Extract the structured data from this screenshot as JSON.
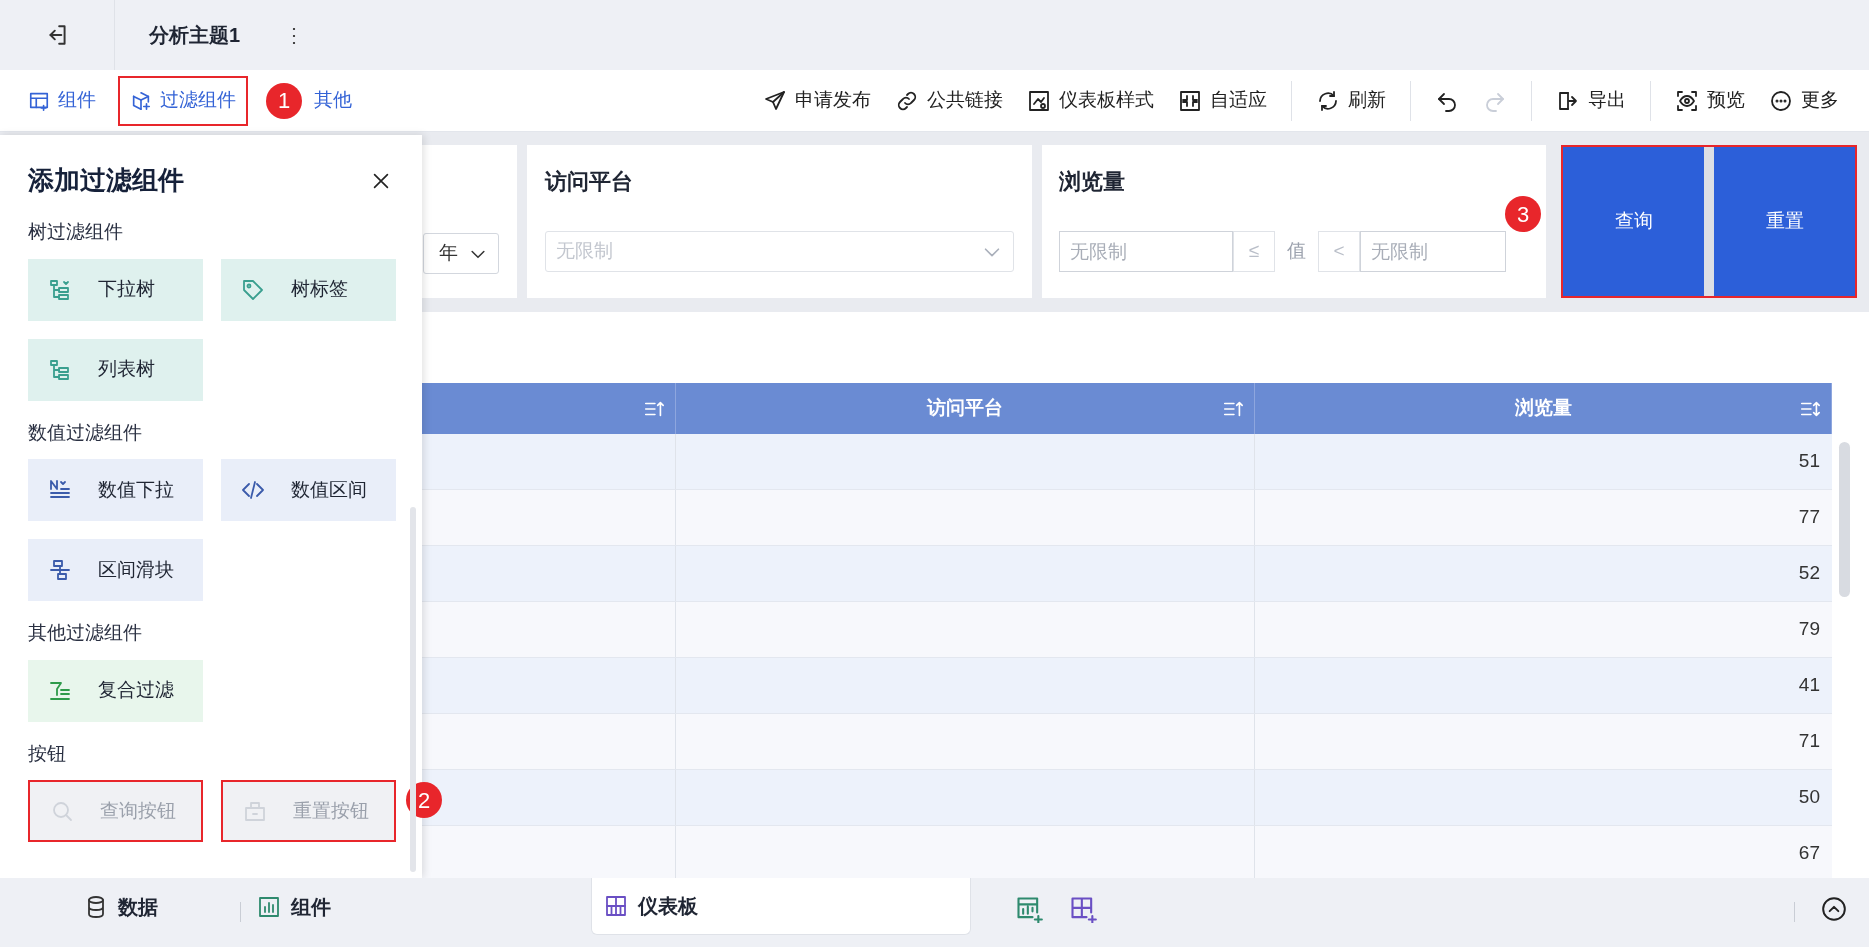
{
  "header": {
    "title": "分析主题1",
    "more": "⋮"
  },
  "toolbar": {
    "tabs": [
      {
        "label": "组件"
      },
      {
        "label": "过滤组件",
        "callout": "1"
      },
      {
        "label": "其他"
      }
    ],
    "groups": [
      [
        {
          "label": "申请发布"
        },
        {
          "label": "公共链接"
        },
        {
          "label": "仪表板样式"
        },
        {
          "label": "自适应"
        }
      ],
      [
        {
          "label": "刷新"
        }
      ],
      [
        {
          "disabled": false
        },
        {
          "disabled": true
        }
      ],
      [
        {
          "label": "导出"
        }
      ],
      [
        {
          "label": "预览"
        },
        {
          "label": "更多"
        }
      ]
    ]
  },
  "panel": {
    "title": "添加过滤组件",
    "callout": "2",
    "sections": [
      {
        "title": "树过滤组件",
        "kind": "tree",
        "items": [
          {
            "label": "下拉树",
            "disabled": false
          },
          {
            "label": "树标签",
            "disabled": false
          },
          {
            "label": "列表树",
            "disabled": false
          }
        ]
      },
      {
        "title": "数值过滤组件",
        "kind": "numeric",
        "items": [
          {
            "label": "数值下拉",
            "disabled": false
          },
          {
            "label": "数值区间",
            "disabled": false
          },
          {
            "label": "区间滑块",
            "disabled": false
          }
        ]
      },
      {
        "title": "其他过滤组件",
        "kind": "other",
        "items": [
          {
            "label": "复合过滤",
            "disabled": false
          }
        ]
      },
      {
        "title": "按钮",
        "kind": "button",
        "items": [
          {
            "label": "查询按钮",
            "disabled": true
          },
          {
            "label": "重置按钮",
            "disabled": true
          }
        ]
      }
    ]
  },
  "filters": {
    "cards": [
      {
        "kind": "year",
        "value": "年"
      },
      {
        "kind": "select",
        "title": "访问平台",
        "placeholder": "无限制"
      },
      {
        "kind": "range",
        "title": "浏览量",
        "min_placeholder": "无限制",
        "operators": [
          "≤",
          "<"
        ],
        "value_label": "值",
        "max_placeholder": "无限制"
      }
    ],
    "buttons": [
      "查询",
      "重置"
    ],
    "callout": "3"
  },
  "table": {
    "columns": [
      {
        "sorted": true
      },
      {
        "label": "访问平台",
        "sorted": true
      },
      {
        "label": "浏览量",
        "sorted": false
      }
    ],
    "rows": [
      {
        "views": "51"
      },
      {
        "views": "77"
      },
      {
        "views": "52"
      },
      {
        "views": "79"
      },
      {
        "views": "41"
      },
      {
        "views": "71"
      },
      {
        "views": "50"
      },
      {
        "views": "67"
      }
    ]
  },
  "bottom_tabs": [
    {
      "label": "数据",
      "selected": false
    },
    {
      "label": "组件",
      "selected": false
    },
    {
      "label": "仪表板",
      "selected": true
    }
  ]
}
